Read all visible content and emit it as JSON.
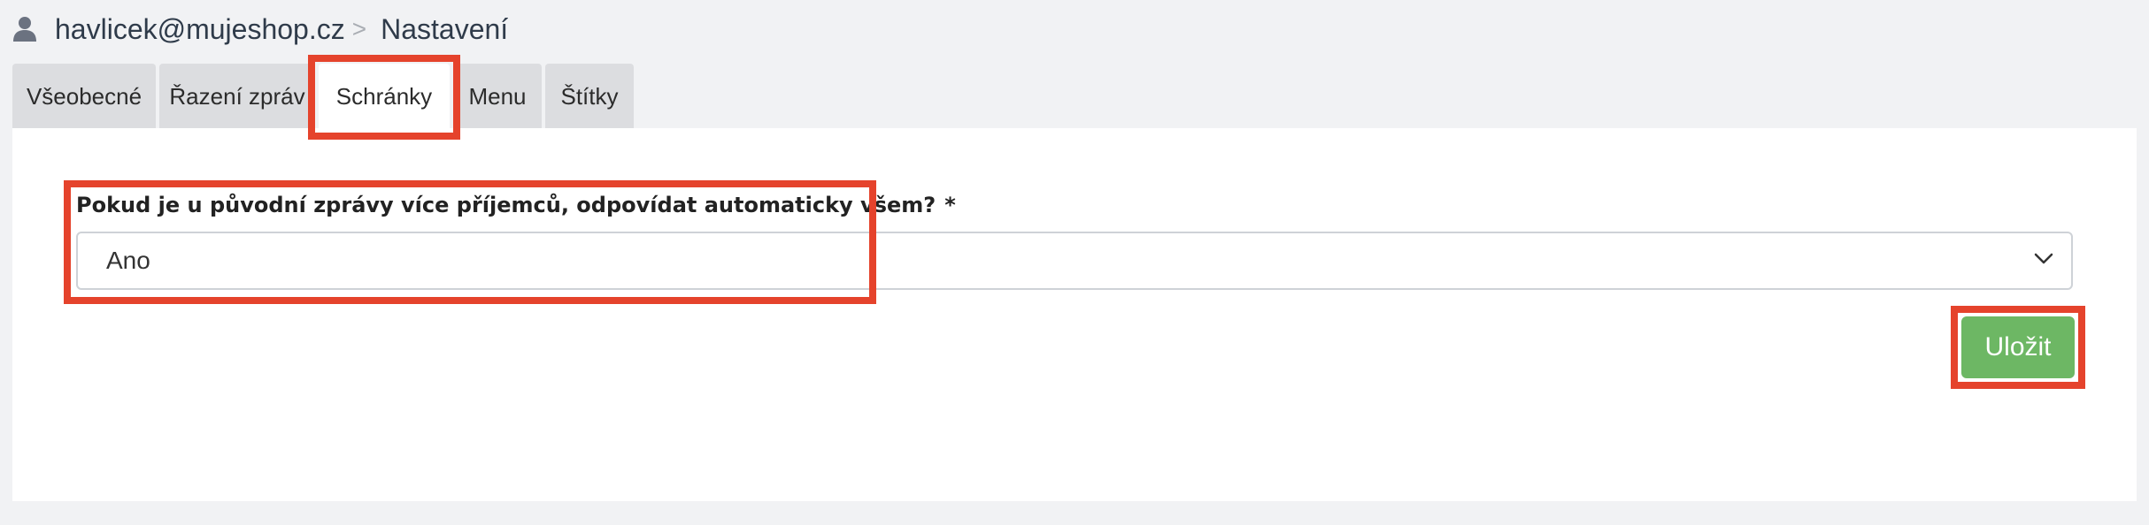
{
  "breadcrumb": {
    "user_icon": "user-icon",
    "account": "havlicek@mujeshop.cz",
    "separator": ">",
    "current": "Nastavení"
  },
  "tabs": [
    {
      "label": "Všeobecné",
      "active": false
    },
    {
      "label": "Řazení zpráv",
      "active": false
    },
    {
      "label": "Schránky",
      "active": true
    },
    {
      "label": "Menu",
      "active": false
    },
    {
      "label": "Štítky",
      "active": false
    }
  ],
  "form": {
    "reply_all": {
      "label": "Pokud je u původní zprávy více příjemců, odpovídat automaticky všem?",
      "required_mark": "*",
      "selected_value": "Ano",
      "dropdown_icon": "chevron-down-icon"
    },
    "save_label": "Uložit"
  },
  "colors": {
    "highlight": "#e5432c",
    "save_button": "#6db764",
    "tab_inactive": "#dcdde0",
    "background": "#f1f2f4"
  }
}
